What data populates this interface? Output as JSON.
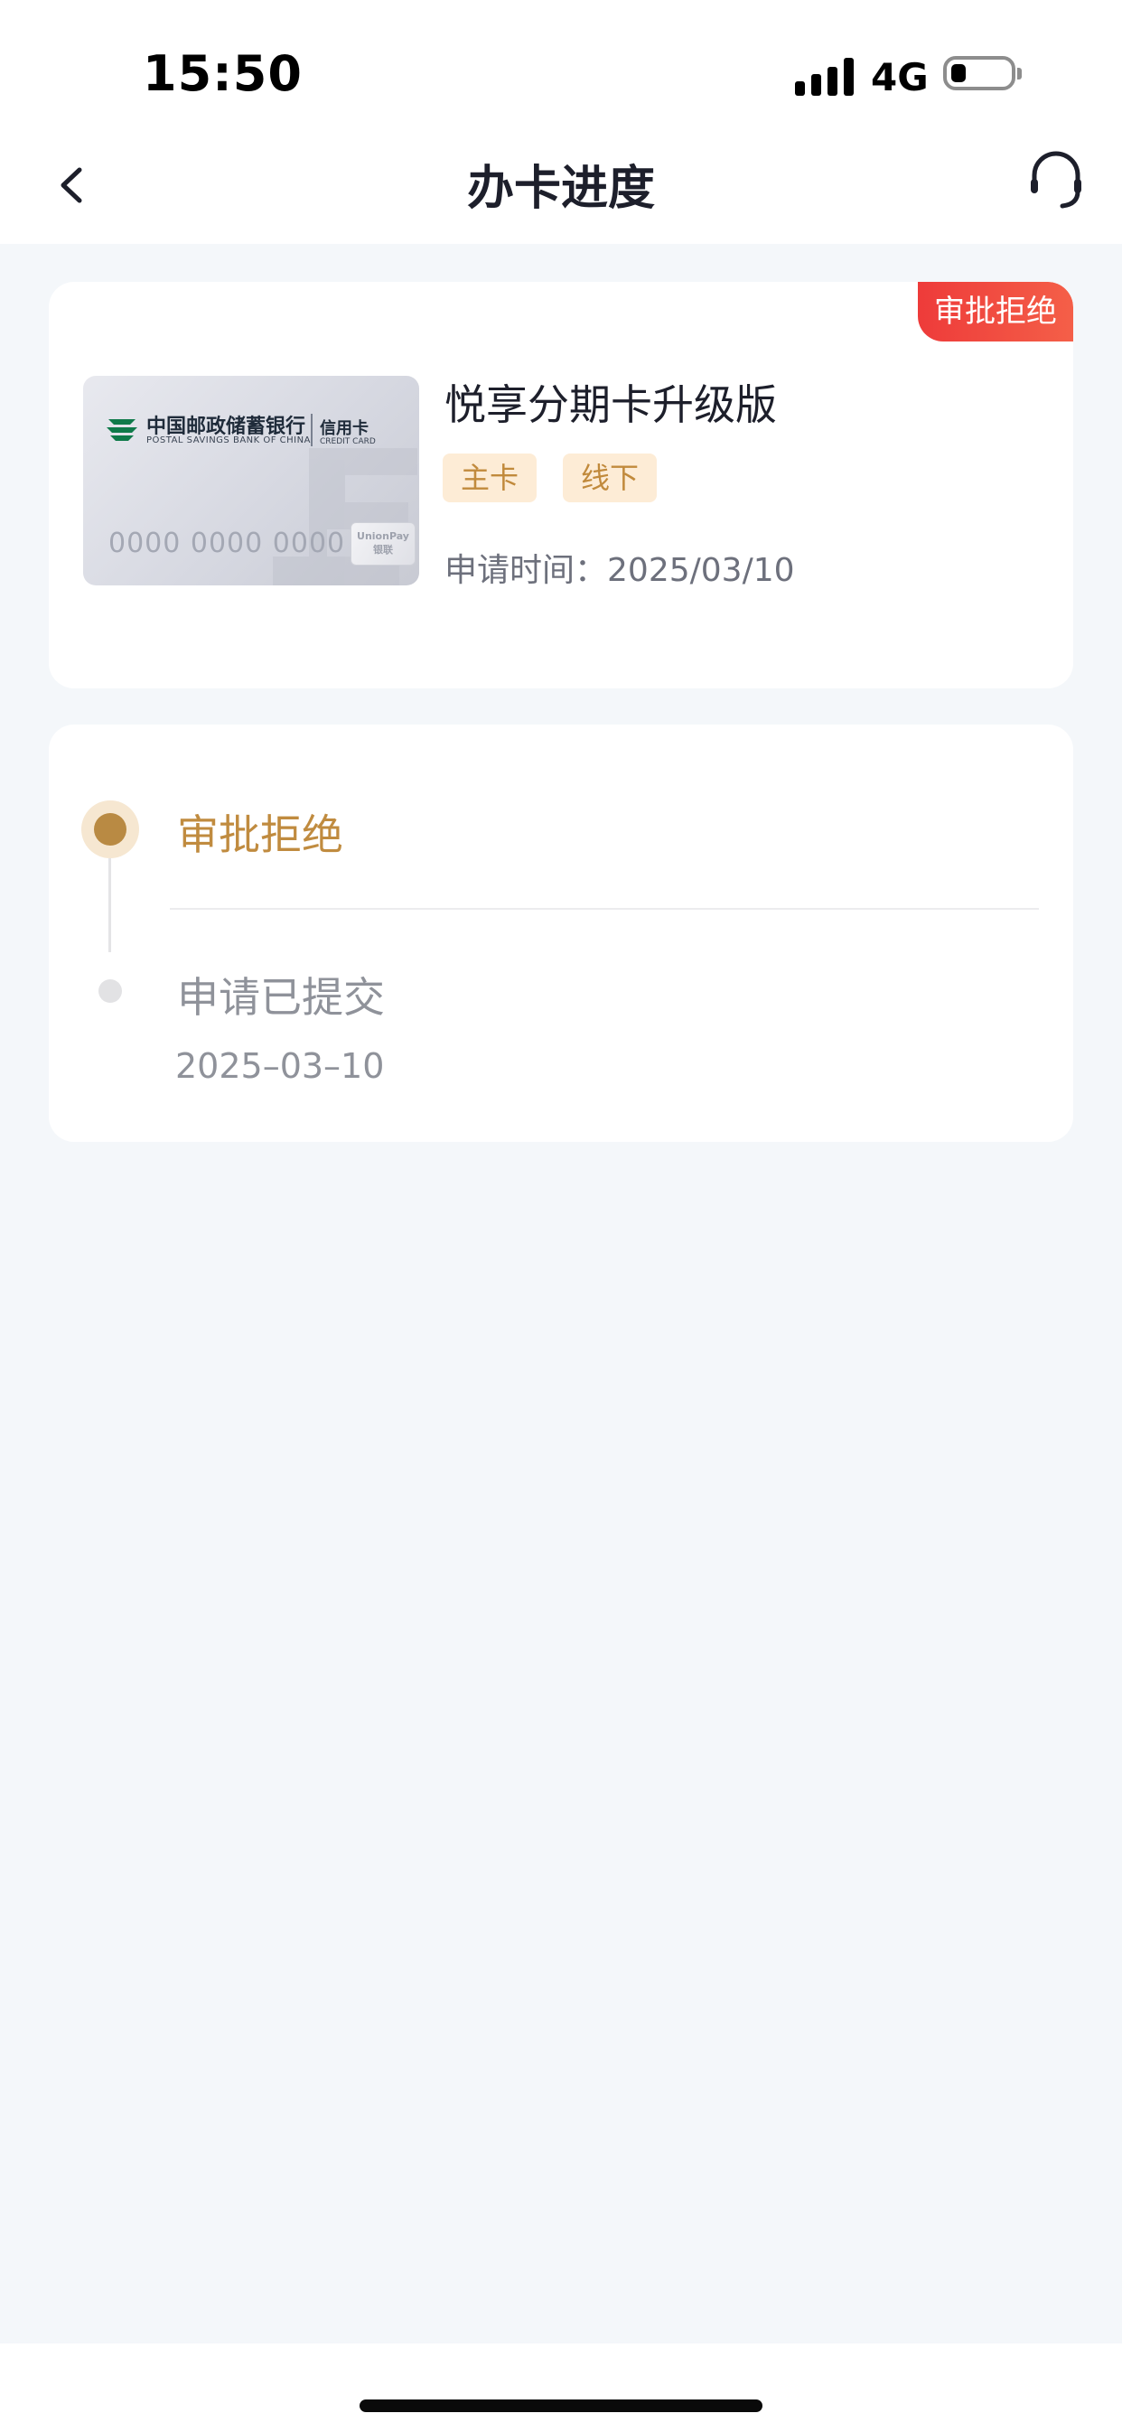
{
  "status_bar": {
    "time": "15:50",
    "network": "4G",
    "battery_level": 0.2
  },
  "nav": {
    "title": "办卡进度",
    "back_icon": "chevron-left-icon",
    "service_icon": "headset-icon"
  },
  "card": {
    "status_badge": "审批拒绝",
    "product_name": "悦享分期卡升级版",
    "tags": [
      "主卡",
      "线下"
    ],
    "apply_time_label": "申请时间：",
    "apply_time_value": "2025/03/10",
    "image": {
      "bank_name": "中国邮政储蓄银行",
      "bank_name_en": "POSTAL SAVINGS BANK OF CHINA",
      "card_type": "信用卡",
      "card_type_en": "CREDIT CARD",
      "card_number": "0000 0000 0000",
      "network_logo": "UnionPay 银联"
    }
  },
  "timeline": {
    "steps": [
      {
        "title": "审批拒绝",
        "date": "",
        "active": true
      },
      {
        "title": "申请已提交",
        "date": "2025–03–10",
        "active": false
      }
    ]
  },
  "colors": {
    "accent_gold": "#c08b3f",
    "badge_red": "#ee3b3a",
    "tag_bg": "#fdecd6",
    "page_bg": "#f4f7fa"
  }
}
